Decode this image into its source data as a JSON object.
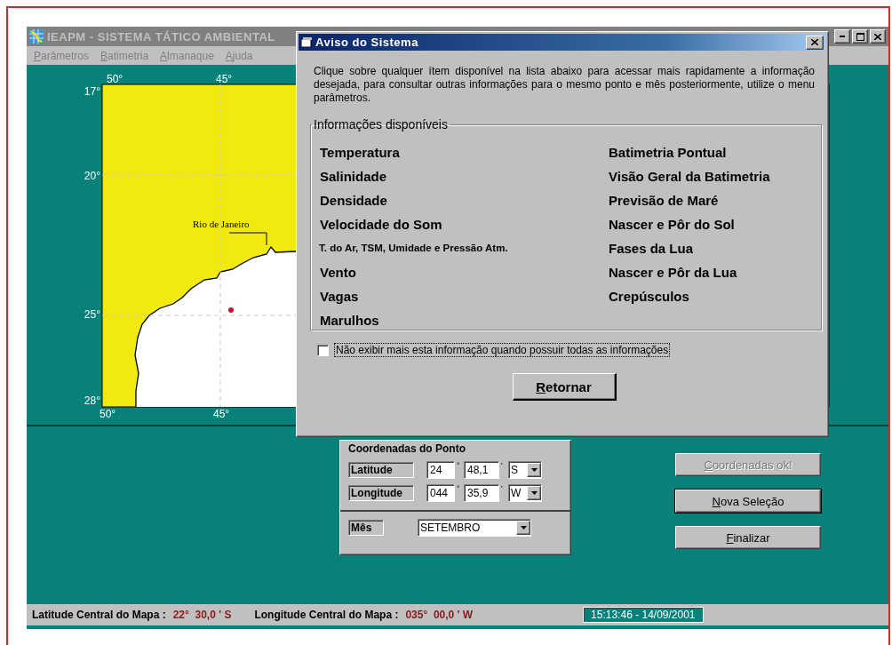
{
  "main_window": {
    "title": "IEAPM - SISTEMA TÁTICO AMBIENTAL",
    "active": false,
    "menu": [
      {
        "label": "Parâmetros"
      },
      {
        "label": "Batimetria"
      },
      {
        "label": "Almanaque"
      },
      {
        "label": "Ajuda"
      }
    ]
  },
  "map": {
    "lon_labels_top": [
      "50°",
      "45°"
    ],
    "lat_labels": [
      "17°",
      "20°",
      "25°",
      "28°"
    ],
    "lon_labels_bottom": [
      "50°",
      "45°"
    ],
    "place": "Rio de Janeiro"
  },
  "dialog": {
    "title": "Aviso do Sistema",
    "active": true,
    "message": "Clique  sobre qualquer ítem disponível na lista abaixo para acessar mais rapidamente a informação desejada, para consultar outras informações para o mesmo ponto e mês posteriormente, utilize o menu parâmetros.",
    "group": "Informações disponíveis",
    "columns": [
      [
        {
          "label": "Temperatura",
          "kind": "normal"
        },
        {
          "label": "Salinidade",
          "kind": "normal"
        },
        {
          "label": "Densidade",
          "kind": "normal"
        },
        {
          "label": "Velocidade do Som",
          "kind": "normal"
        },
        {
          "label": "T. do Ar, TSM, Umidade e Pressão Atm.",
          "kind": "compact"
        },
        {
          "label": "Vento",
          "kind": "normal"
        },
        {
          "label": "Vagas",
          "kind": "normal"
        },
        {
          "label": "Marulhos",
          "kind": "normal"
        }
      ],
      [
        {
          "label": "Batimetria Pontual",
          "kind": "normal"
        },
        {
          "label": "Visão Geral da Batimetria",
          "kind": "normal"
        },
        {
          "label": "Previsão de Maré",
          "kind": "normal"
        },
        {
          "label": "Nascer e Pôr do Sol",
          "kind": "normal"
        },
        {
          "label": "Fases da Lua",
          "kind": "normal"
        },
        {
          "label": "Nascer e Pôr da Lua",
          "kind": "normal"
        },
        {
          "label": "Crepúsculos",
          "kind": "normal"
        }
      ]
    ],
    "checkbox": {
      "label": "Não exibir mais esta informação quando possuir todas as informações",
      "checked": false
    },
    "button": {
      "label": "Retornar"
    }
  },
  "coords": {
    "title": "Coordenadas do Ponto",
    "rows": [
      {
        "label": "Latitude",
        "degrees": "24",
        "degree_mark": "°",
        "minutes": "48,1",
        "minute_mark": "'",
        "hemisphere": "S"
      },
      {
        "label": "Longitude",
        "degrees": "044",
        "degree_mark": "°",
        "minutes": "35,9",
        "minute_mark": "'",
        "hemisphere": "W"
      }
    ],
    "month": {
      "label": "Mês",
      "value": "SETEMBRO"
    }
  },
  "buttons": [
    {
      "label": "Coordenadas ok!",
      "disabled": true,
      "default": false
    },
    {
      "label": "Nova Seleção",
      "disabled": false,
      "default": true
    },
    {
      "label": "Finalizar",
      "disabled": false,
      "default": false
    }
  ],
  "status_bar": {
    "lat_label": "Latitude Central do Mapa :",
    "lat_value": "22°  30,0 ' S",
    "lon_label": "Longitude Central do Mapa :",
    "lon_value": "035°  00,0 ' W",
    "clock": "15:13:46 - 14/09/2001"
  }
}
